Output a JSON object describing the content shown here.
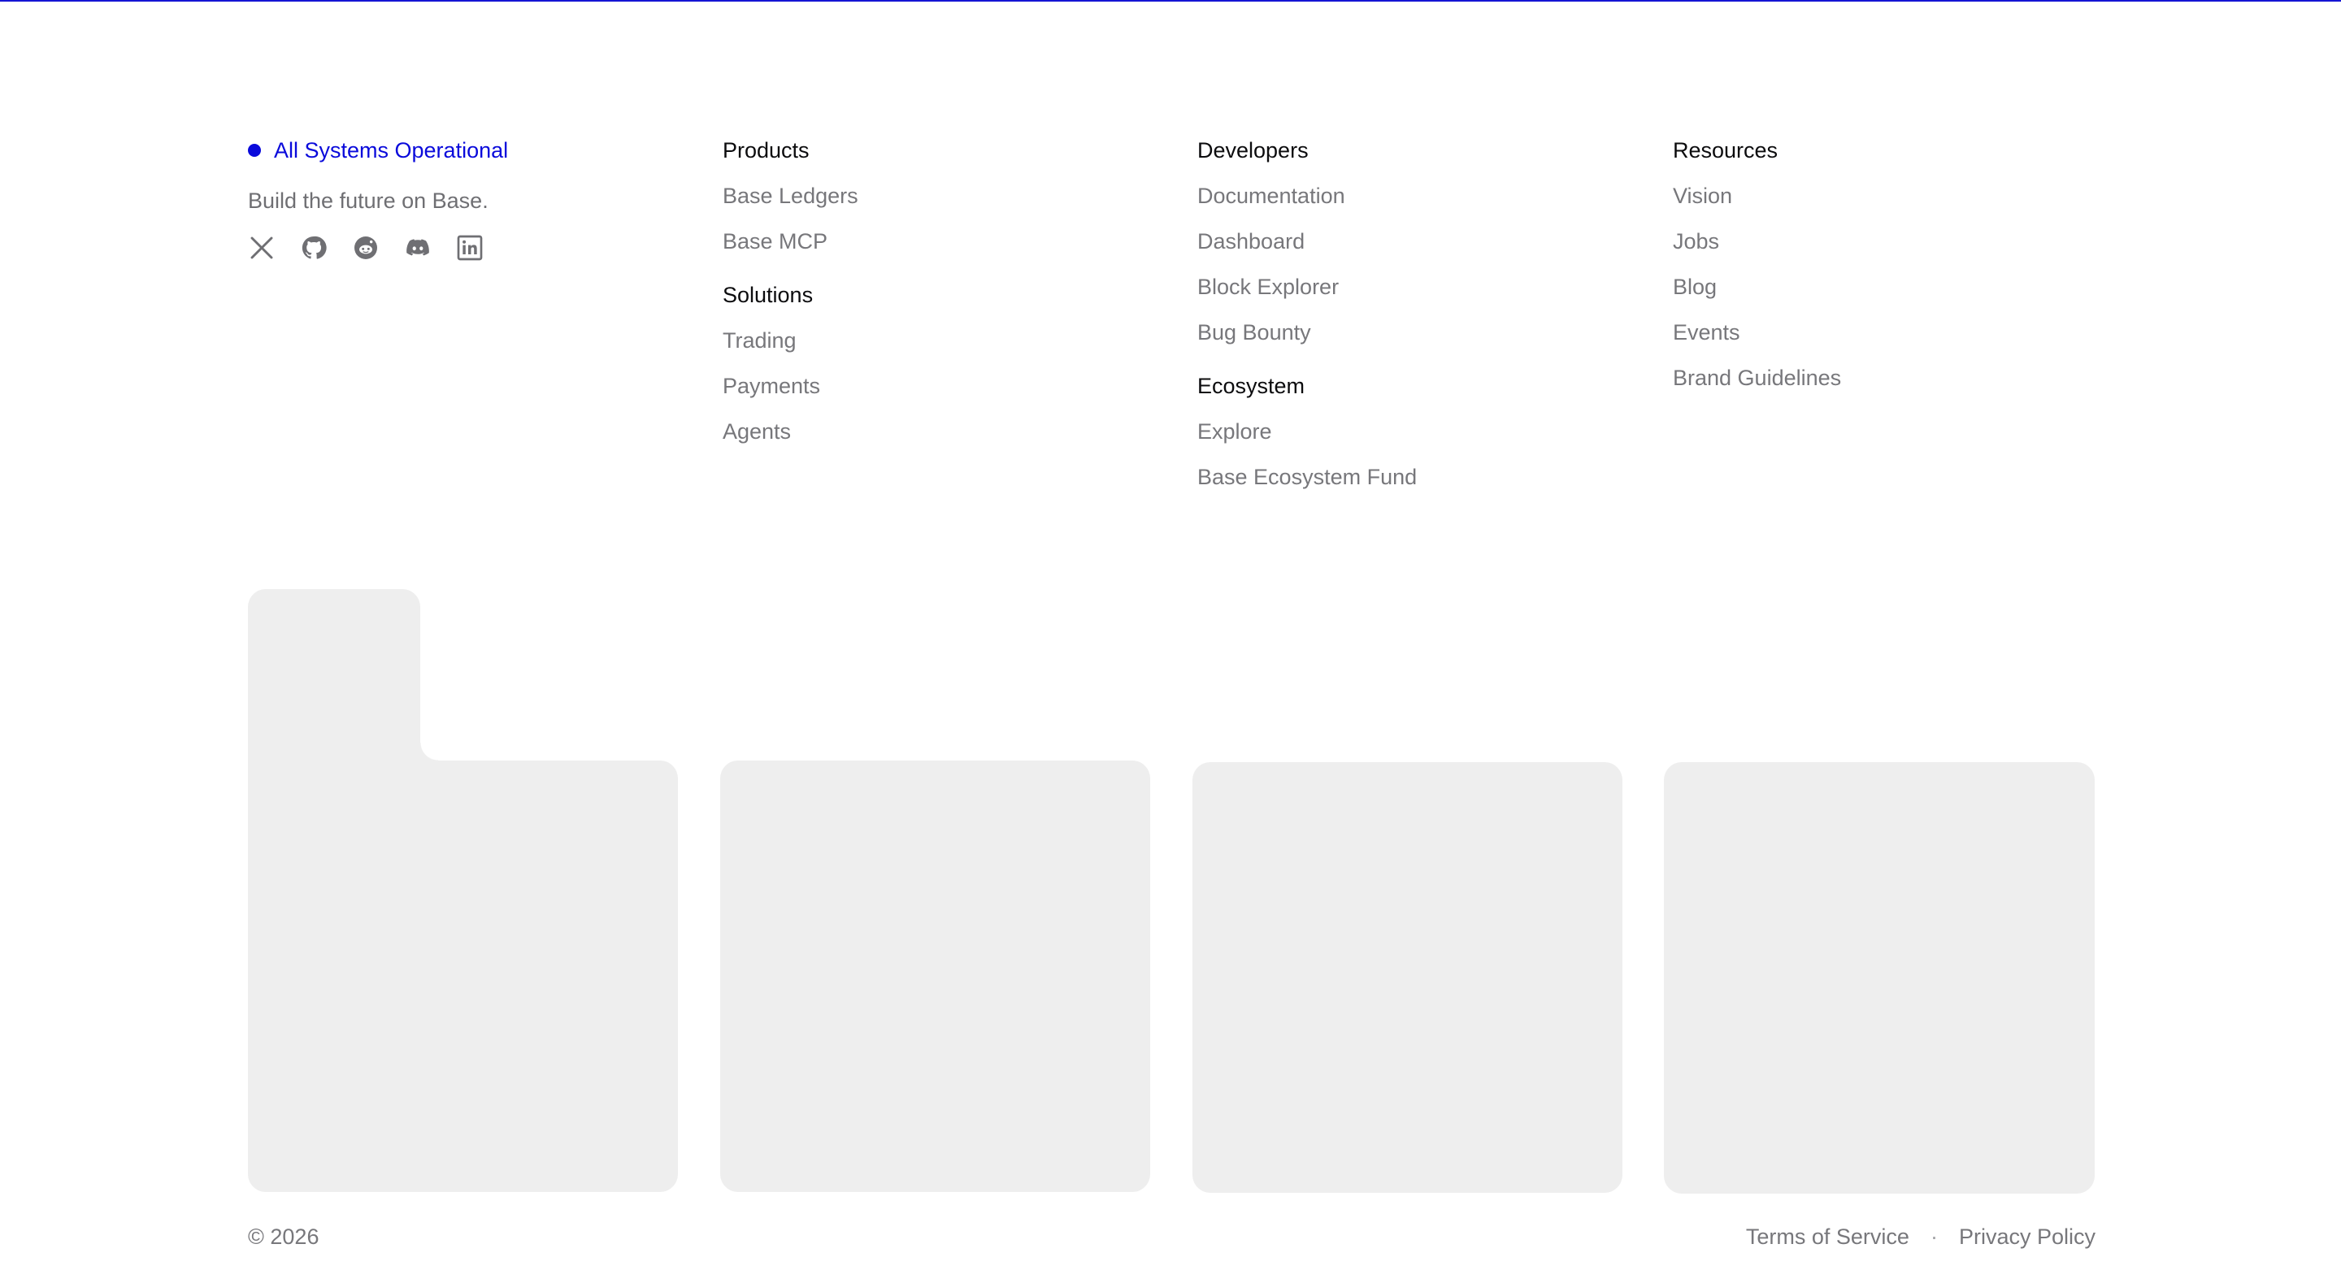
{
  "status": {
    "label": "All Systems Operational",
    "color": "#0a0adb"
  },
  "brand": {
    "tagline": "Build the future on Base."
  },
  "socials": [
    {
      "name": "x-icon"
    },
    {
      "name": "github-icon"
    },
    {
      "name": "reddit-icon"
    },
    {
      "name": "discord-icon"
    },
    {
      "name": "linkedin-icon"
    }
  ],
  "products": {
    "heading": "Products",
    "links": [
      "Base Ledgers",
      "Base MCP"
    ]
  },
  "solutions": {
    "heading": "Solutions",
    "links": [
      "Trading",
      "Payments",
      "Agents"
    ]
  },
  "developers": {
    "heading": "Developers",
    "links": [
      "Documentation",
      "Dashboard",
      "Block Explorer",
      "Bug Bounty"
    ]
  },
  "ecosystem": {
    "heading": "Ecosystem",
    "links": [
      "Explore",
      "Base Ecosystem Fund"
    ]
  },
  "resources": {
    "heading": "Resources",
    "links": [
      "Vision",
      "Jobs",
      "Blog",
      "Events",
      "Brand Guidelines"
    ]
  },
  "bottom": {
    "copyright": "© 2026",
    "separator": "·",
    "terms": "Terms of Service",
    "privacy": "Privacy Policy"
  },
  "colors": {
    "accent": "#0a0adb",
    "tile": "#eeeeee",
    "muted_text": "#77777b"
  }
}
